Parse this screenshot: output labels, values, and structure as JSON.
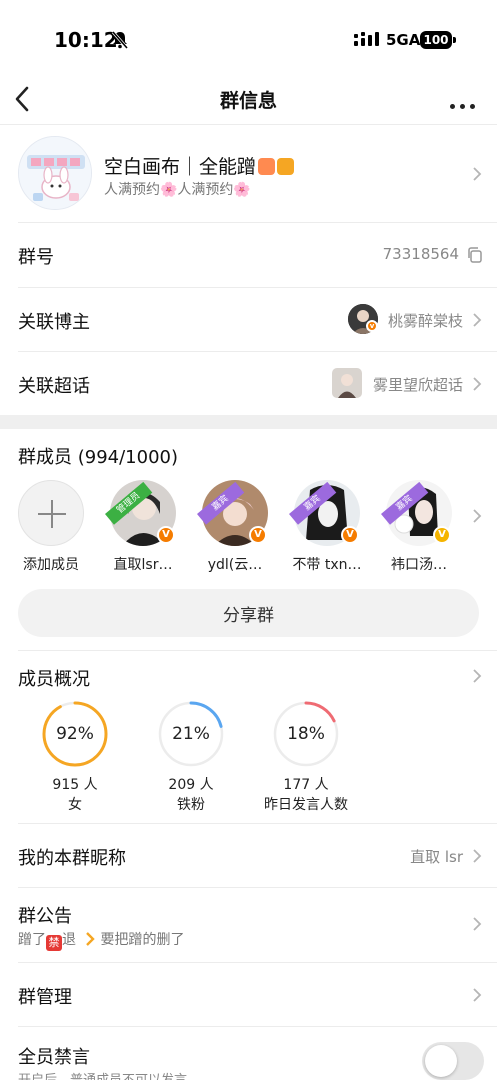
{
  "status_bar": {
    "time": "10:12",
    "network": "5GA",
    "battery": "100"
  },
  "nav": {
    "title": "群信息"
  },
  "group": {
    "name": "空白画布｜全能蹭",
    "subtitle": "人满预约🌸人满预约🌸"
  },
  "rows": {
    "group_id": {
      "label": "群号",
      "value": "73318564"
    },
    "blogger": {
      "label": "关联博主",
      "value": "桃雾醉棠枝"
    },
    "supertopic": {
      "label": "关联超话",
      "value": "雾里望欣超话"
    }
  },
  "members": {
    "title": "群成员 (994/1000)",
    "add_label": "添加成员",
    "list": [
      {
        "name": "直取lsr…",
        "ribbon": "管理员",
        "badge": "V"
      },
      {
        "name": "ydl(云…",
        "ribbon": "嘉宾",
        "badge": "V"
      },
      {
        "name": "不带 txn…",
        "ribbon": "嘉宾",
        "badge": "V"
      },
      {
        "name": "袆口汤…",
        "ribbon": "嘉宾",
        "badge": "V"
      }
    ],
    "share_label": "分享群"
  },
  "overview": {
    "title": "成员概况",
    "stats": [
      {
        "percent": "92%",
        "count": "915 人",
        "label": "女",
        "fraction": 0.92,
        "color": "#f5a623"
      },
      {
        "percent": "21%",
        "count": "209 人",
        "label": "铁粉",
        "fraction": 0.21,
        "color": "#5aa6f0"
      },
      {
        "percent": "18%",
        "count": "177 人",
        "label": "昨日发言人数",
        "fraction": 0.18,
        "color": "#ef6b73"
      }
    ]
  },
  "nickname": {
    "label": "我的本群昵称",
    "value": "直取 lsr"
  },
  "notice": {
    "label": "群公告",
    "text_a": "蹭了",
    "ban_char": "禁",
    "text_b": "退",
    "text_c": "要把蹭的删了"
  },
  "manage": {
    "label": "群管理"
  },
  "mute_all": {
    "label": "全员禁言",
    "hint": "开启后，普通成员不可以发言"
  },
  "colors": {
    "admin_ribbon": "#3cb043",
    "guest_ribbon": "#9c6ade",
    "v_orange": "#f57c00",
    "v_gold": "#f5b400"
  }
}
